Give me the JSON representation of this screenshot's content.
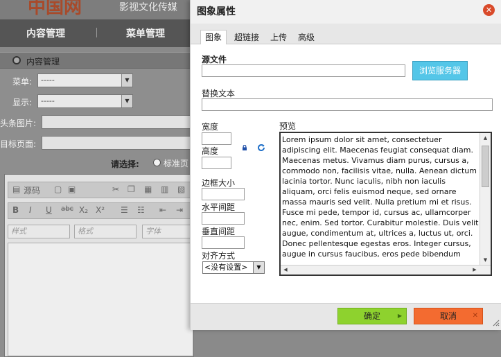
{
  "background": {
    "brand_logo": "中国网",
    "brand_slogan": "影视文化传媒",
    "nav": [
      "内容管理",
      "菜单管理"
    ],
    "panel_title": "内容管理",
    "labels": {
      "menu": "菜单:",
      "display": "显示:",
      "headline_image": "头条图片:",
      "target_page": "目标页面:",
      "choose": "请选择:",
      "radio_standard": "标准页"
    },
    "select_menu_value": "-----",
    "select_display_value": "-----",
    "toolbar_source": "源码",
    "toolbar_row2": [
      "B",
      "I",
      "U",
      "abc",
      "X₂",
      "X²"
    ],
    "combos": [
      "样式",
      "格式",
      "字体"
    ]
  },
  "dialog": {
    "title": "图象属性",
    "tabs": [
      "图象",
      "超链接",
      "上传",
      "高级"
    ],
    "active_tab": 0,
    "source_file_label": "源文件",
    "source_file_value": "",
    "browse_button": "浏览服务器",
    "alt_text_label": "替换文本",
    "alt_text_value": "",
    "width_label": "宽度",
    "height_label": "高度",
    "border_label": "边框大小",
    "hspace_label": "水平间距",
    "vspace_label": "垂直间距",
    "align_label": "对齐方式",
    "align_value": "<没有设置>",
    "preview_label": "预览",
    "preview_text": "Lorem ipsum dolor sit amet, consectetuer adipiscing elit. Maecenas feugiat consequat diam. Maecenas metus. Vivamus diam purus, cursus a, commodo non, facilisis vitae, nulla. Aenean dictum lacinia tortor. Nunc iaculis, nibh non iaculis aliquam, orci felis euismod neque, sed ornare massa mauris sed velit. Nulla pretium mi et risus. Fusce mi pede, tempor id, cursus ac, ullamcorper nec, enim. Sed tortor. Curabitur molestie. Duis velit augue, condimentum at, ultrices a, luctus ut, orci. Donec pellentesque egestas eros. Integer cursus, augue in cursus faucibus, eros pede bibendum",
    "ok_button": "确定",
    "cancel_button": "取消",
    "close_glyph": "✕"
  },
  "colors": {
    "browse_button": "#54c6e8",
    "ok_button": "#8ed22e",
    "cancel_button": "#f36b30",
    "close_button": "#d94a2a"
  }
}
